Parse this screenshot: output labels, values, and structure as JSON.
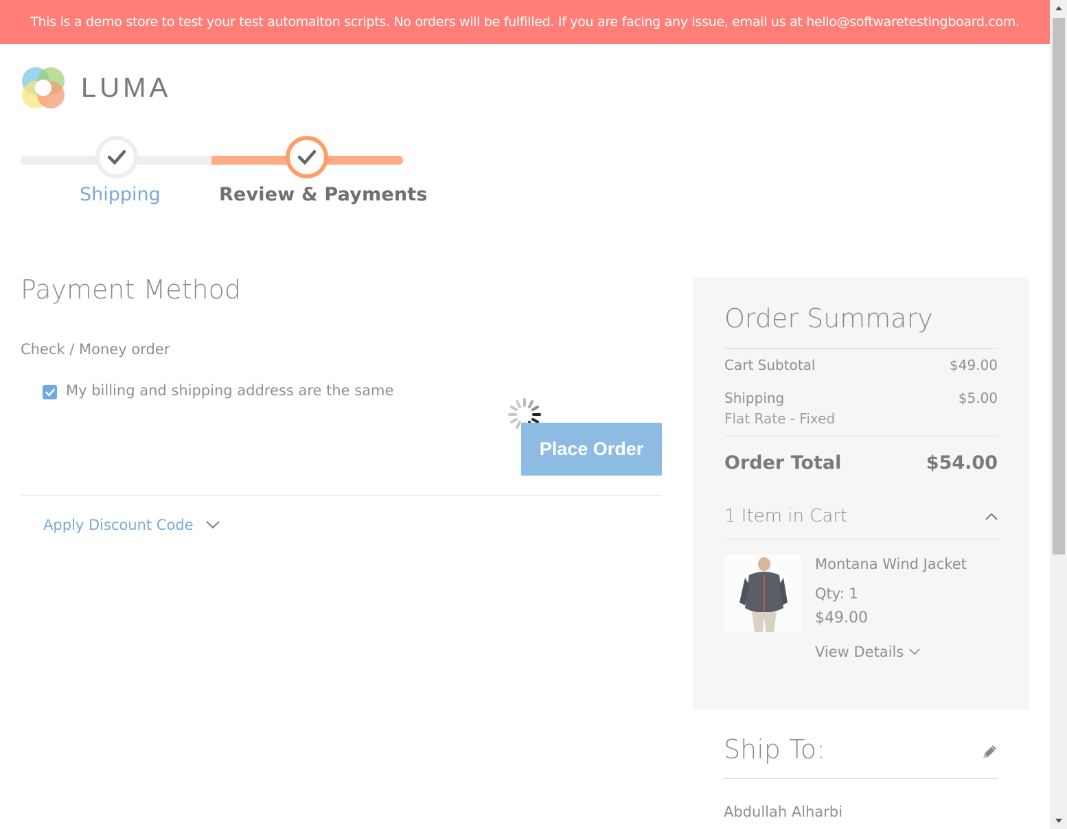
{
  "banner": {
    "text": "This is a demo store to test your test automaiton scripts. No orders will be fulfilled. If you are facing any issue, email us at hello@softwaretestingboard.com."
  },
  "logo": {
    "text": "LUMA"
  },
  "progress": {
    "steps": [
      {
        "label": "Shipping",
        "state": "complete"
      },
      {
        "label": "Review & Payments",
        "state": "active"
      }
    ]
  },
  "payment": {
    "title": "Payment Method",
    "method_label": "Check / Money order",
    "billing_same_label": "My billing and shipping address are the same",
    "billing_same_checked": true,
    "place_order_label": "Place Order",
    "discount_label": "Apply Discount Code"
  },
  "summary": {
    "title": "Order Summary",
    "cart_subtotal_label": "Cart Subtotal",
    "cart_subtotal_value": "$49.00",
    "shipping_label": "Shipping",
    "shipping_value": "$5.00",
    "shipping_method": "Flat Rate - Fixed",
    "order_total_label": "Order Total",
    "order_total_value": "$54.00",
    "items_title": "1 Item in Cart",
    "item": {
      "name": "Montana Wind Jacket",
      "qty": "Qty: 1",
      "price": "$49.00",
      "view_details_label": "View Details"
    }
  },
  "ship_to": {
    "title": "Ship To:",
    "name": "Abdullah Alharbi"
  },
  "colors": {
    "banner": "#ff7f78",
    "accent_orange": "#ffab85",
    "link_blue": "#7ba9d6",
    "button_blue": "#8dbbe2"
  }
}
